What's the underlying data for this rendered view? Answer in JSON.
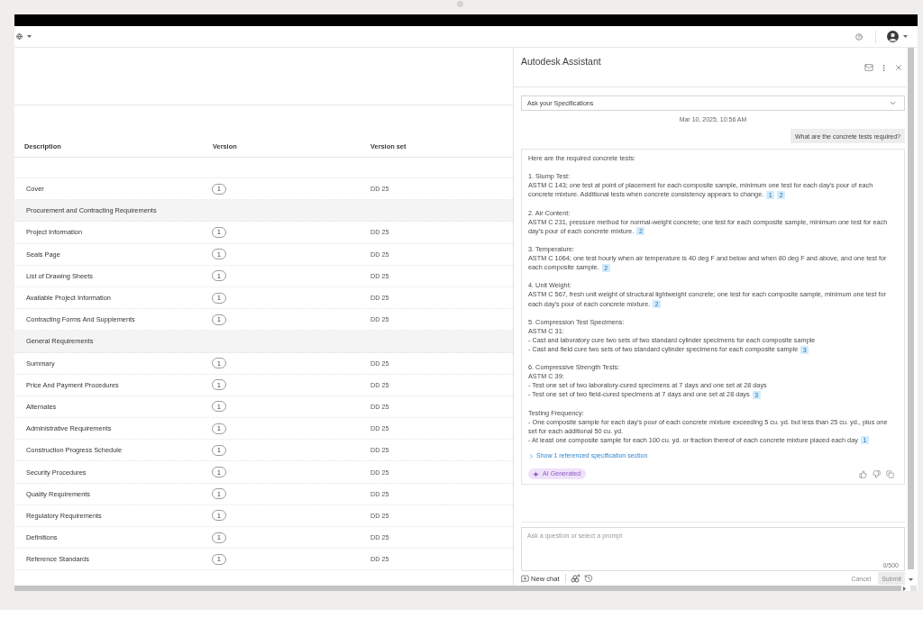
{
  "table": {
    "columns": [
      "Description",
      "Version",
      "Version set"
    ],
    "rows": [
      {
        "kind": "item",
        "description": "Cover",
        "version": "1",
        "version_set": "DD 25"
      },
      {
        "kind": "group",
        "description": "Procurement and Contracting Requirements"
      },
      {
        "kind": "item",
        "description": "Project Information",
        "version": "1",
        "version_set": "DD 25"
      },
      {
        "kind": "item",
        "description": "Seals Page",
        "version": "1",
        "version_set": "DD 25"
      },
      {
        "kind": "item",
        "description": "List of Drawing Sheets",
        "version": "1",
        "version_set": "DD 25"
      },
      {
        "kind": "item",
        "description": "Available Project Information",
        "version": "1",
        "version_set": "DD 25"
      },
      {
        "kind": "item",
        "description": "Contracting Forms And Supplements",
        "version": "1",
        "version_set": "DD 25"
      },
      {
        "kind": "group",
        "description": "General Requirements"
      },
      {
        "kind": "item",
        "description": "Summary",
        "version": "1",
        "version_set": "DD 25"
      },
      {
        "kind": "item",
        "description": "Price And Payment Procedures",
        "version": "1",
        "version_set": "DD 25"
      },
      {
        "kind": "item",
        "description": "Alternates",
        "version": "1",
        "version_set": "DD 25"
      },
      {
        "kind": "item",
        "description": "Administrative Requirements",
        "version": "1",
        "version_set": "DD 25"
      },
      {
        "kind": "item",
        "description": "Construction Progress Schedule",
        "version": "1",
        "version_set": "DD 25"
      },
      {
        "kind": "item",
        "description": "Security Procedures",
        "version": "1",
        "version_set": "DD 25"
      },
      {
        "kind": "item",
        "description": "Quality Requirements",
        "version": "1",
        "version_set": "DD 25"
      },
      {
        "kind": "item",
        "description": "Regulatory Requirements",
        "version": "1",
        "version_set": "DD 25"
      },
      {
        "kind": "item",
        "description": "Definitions",
        "version": "1",
        "version_set": "DD 25"
      },
      {
        "kind": "item",
        "description": "Reference Standards",
        "version": "1",
        "version_set": "DD 25"
      }
    ]
  },
  "assistant": {
    "title": "Autodesk Assistant",
    "source_select": {
      "value": "Ask your Specifications"
    },
    "timestamp": "Mar 10, 2025, 10:56 AM",
    "user_message": "What are the concrete tests required?",
    "response": {
      "intro": "Here are the required concrete tests:",
      "sections": [
        {
          "title": "1. Slump Test:",
          "lines": [
            {
              "text": "ASTM C 143; one test at point of placement for each composite sample, minimum one test for each day's pour of each concrete mixture. Additional tests when concrete consistency appears to change.",
              "citations": [
                "1",
                "2"
              ]
            }
          ]
        },
        {
          "title": "2. Air Content:",
          "lines": [
            {
              "text": "ASTM C 231, pressure method for normal-weight concrete; one test for each composite sample, minimum one test for each day's pour of each concrete mixture.",
              "citations": [
                "2"
              ]
            }
          ]
        },
        {
          "title": "3. Temperature:",
          "lines": [
            {
              "text": "ASTM C 1064; one test hourly when air temperature is 40 deg F and below and when 80 deg F and above, and one test for each composite sample.",
              "citations": [
                "2"
              ]
            }
          ]
        },
        {
          "title": "4. Unit Weight:",
          "lines": [
            {
              "text": "ASTM C 567, fresh unit weight of structural lightweight concrete; one test for each composite sample, minimum one test for each day's pour of each concrete mixture.",
              "citations": [
                "2"
              ]
            }
          ]
        },
        {
          "title": "5. Compression Test Specimens:",
          "lines": [
            {
              "text": "ASTM C 31:"
            },
            {
              "text": "- Cast and laboratory cure two sets of two standard cylinder specimens for each composite sample"
            },
            {
              "text": "- Cast and field cure two sets of two standard cylinder specimens for each composite sample",
              "citations": [
                "3"
              ]
            }
          ]
        },
        {
          "title": "6. Compressive Strength Tests:",
          "lines": [
            {
              "text": "ASTM C 39:"
            },
            {
              "text": "- Test one set of two laboratory-cured specimens at 7 days and one set at 28 days"
            },
            {
              "text": "- Test one set of two field-cured specimens at 7 days and one set at 28 days",
              "citations": [
                "3"
              ]
            }
          ]
        },
        {
          "title": "Testing Frequency:",
          "lines": [
            {
              "text": "- One composite sample for each day's pour of each concrete mixture exceeding 5 cu. yd. but less than 25 cu. yd., plus one set for each additional 50 cu. yd."
            },
            {
              "text": "- At least one composite sample for each 100 cu. yd. or fraction thereof of each concrete mixture placed each day",
              "citations": [
                "1"
              ]
            }
          ]
        }
      ],
      "references_link": "Show 1 referenced specification section",
      "badge": "AI Generated"
    },
    "input": {
      "placeholder": "Ask a question or select a prompt",
      "counter": "0/500"
    },
    "footer": {
      "new_chat": "New chat",
      "actions": [
        {
          "kind": "text",
          "label": "Cancel",
          "disabled": true
        },
        {
          "kind": "filled",
          "label": "Submit",
          "disabled": true
        }
      ]
    }
  }
}
